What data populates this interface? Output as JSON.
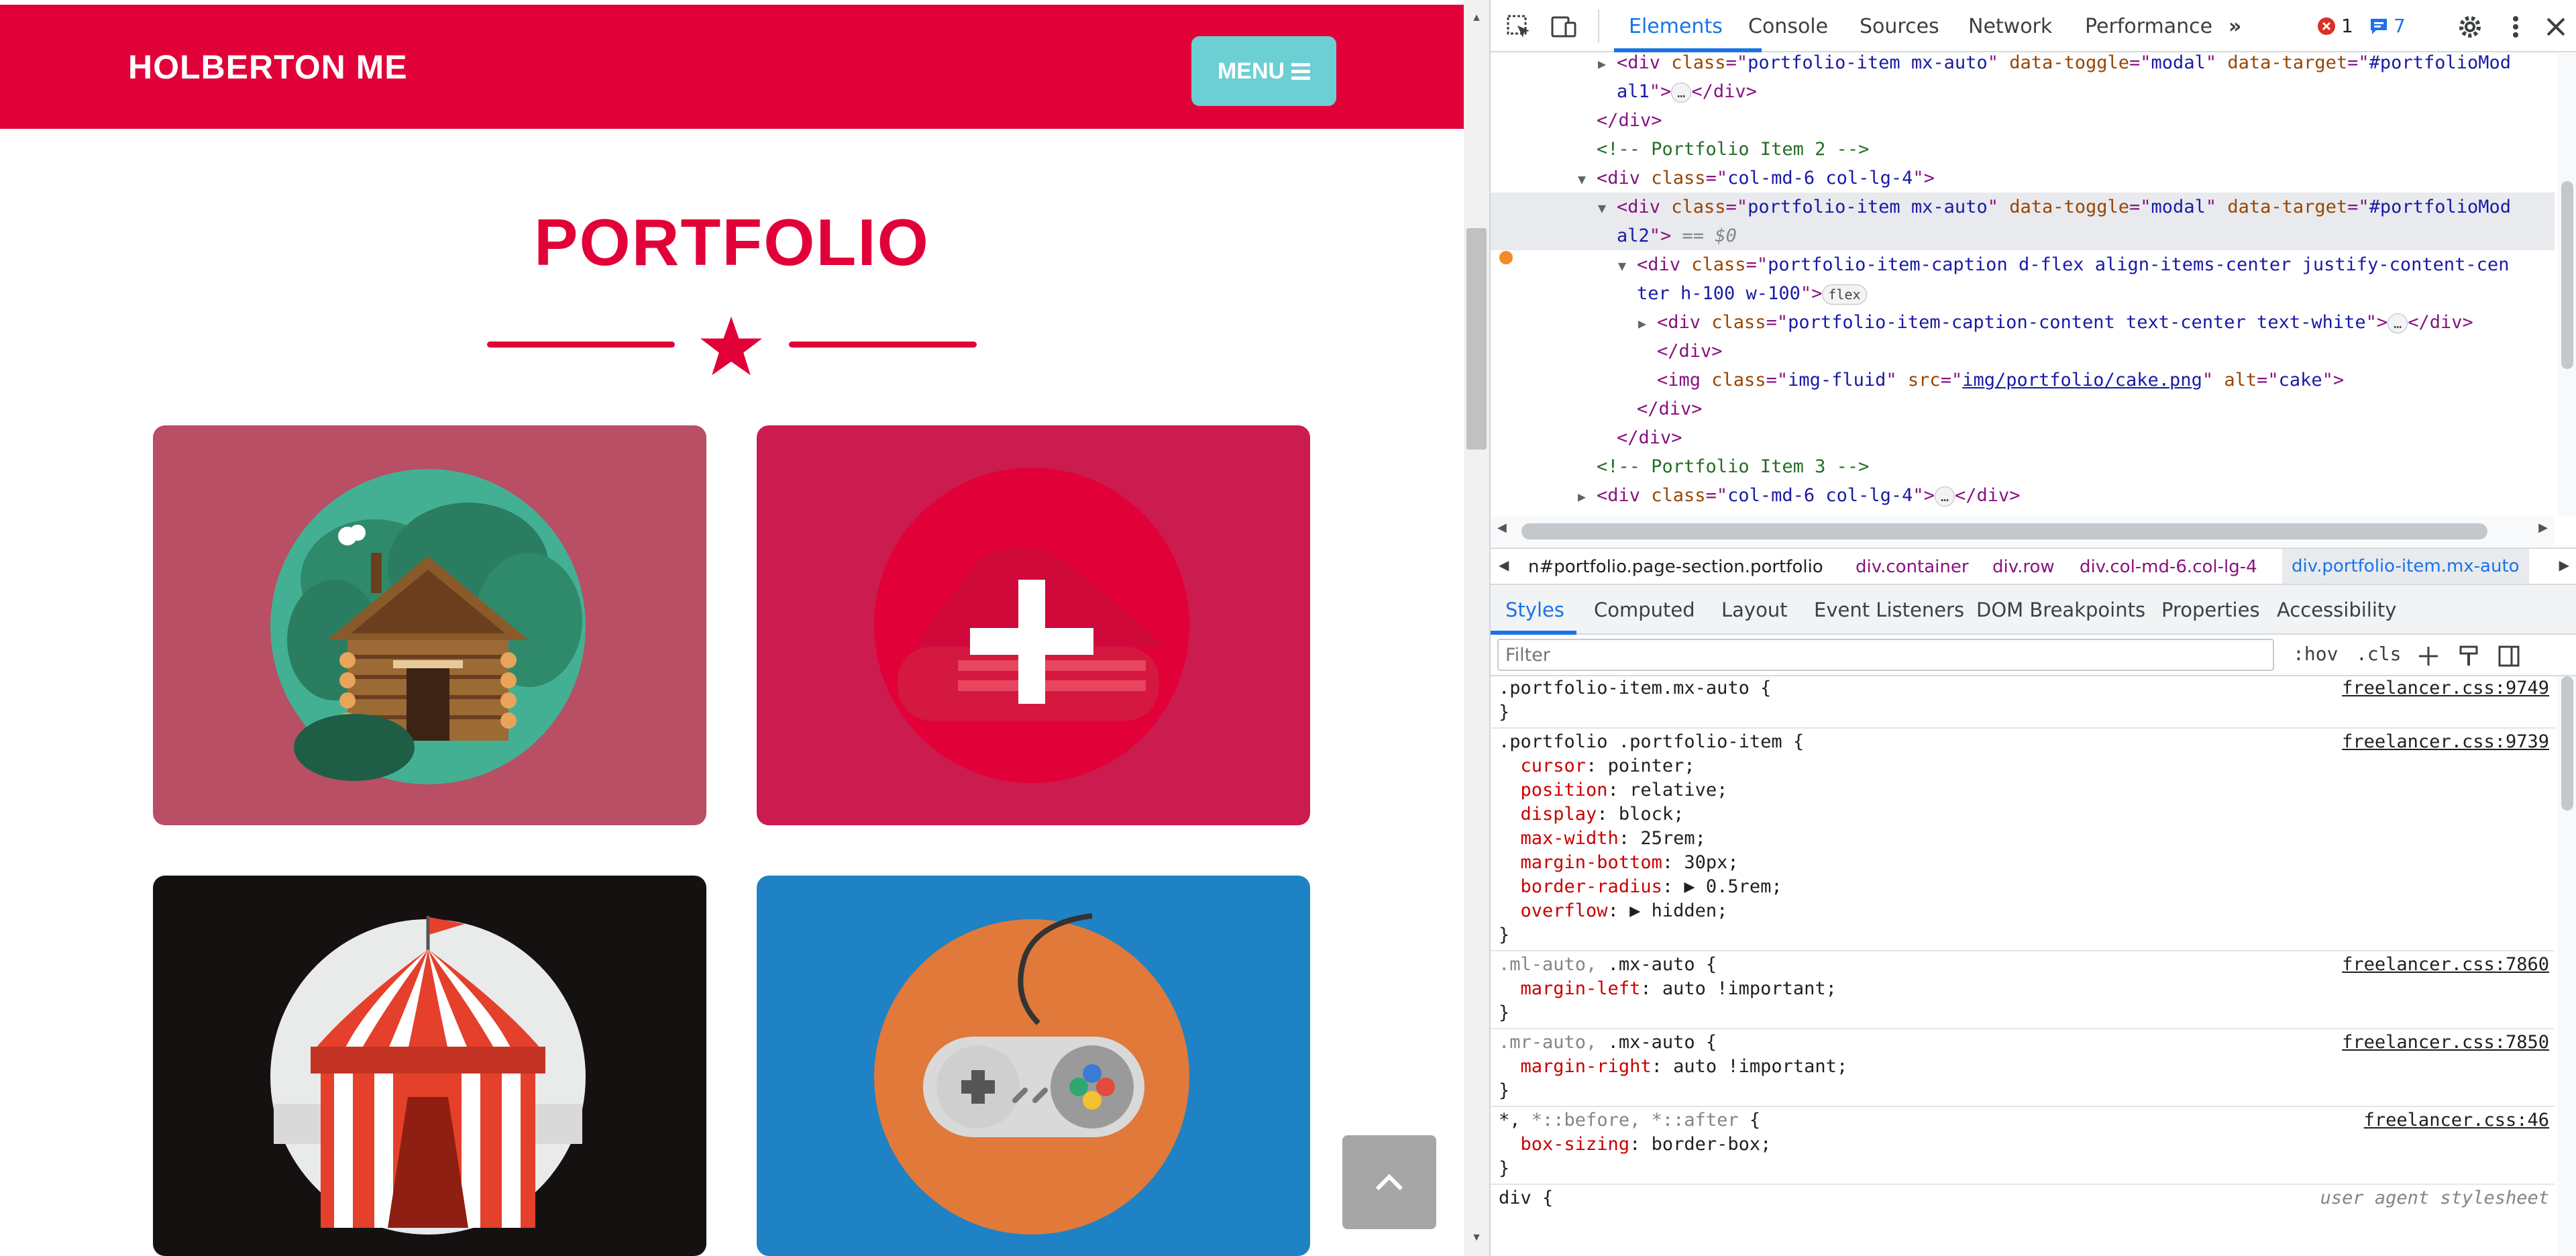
{
  "site": {
    "brand": "HOLBERTON ME",
    "menu_label": "MENU",
    "section_title": "PORTFOLIO",
    "portfolio_items": [
      {
        "name": "cabin",
        "bg": "#b84f64"
      },
      {
        "name": "cake",
        "bg": "#cc1b4e"
      },
      {
        "name": "circus",
        "bg": "#161111"
      },
      {
        "name": "game",
        "bg": "#1e82c4"
      }
    ],
    "colors": {
      "primary": "#e10038",
      "menu": "#6ccfd3"
    }
  },
  "devtools": {
    "tabs": [
      "Elements",
      "Console",
      "Sources",
      "Network",
      "Performance"
    ],
    "active_tab": "Elements",
    "more_tabs": "»",
    "error_count": "1",
    "message_count": "7",
    "dom_lines": [
      {
        "indent": 5,
        "tri": "▶",
        "parts": [
          [
            "tg",
            "<div "
          ],
          [
            "an",
            "class"
          ],
          [
            "tg",
            "=\""
          ],
          [
            "av",
            "portfolio-item mx-auto"
          ],
          [
            "tg",
            "\" "
          ],
          [
            "an",
            "data-toggle"
          ],
          [
            "tg",
            "=\""
          ],
          [
            "av",
            "modal"
          ],
          [
            "tg",
            "\" "
          ],
          [
            "an",
            "data-target"
          ],
          [
            "tg",
            "=\""
          ],
          [
            "av",
            "#portfolioMod"
          ]
        ]
      },
      {
        "indent": 5,
        "tri": "",
        "parts": [
          [
            "av",
            "al1"
          ],
          [
            "tg",
            "\">"
          ],
          [
            "pill",
            "…"
          ],
          [
            "tg",
            "</div>"
          ]
        ]
      },
      {
        "indent": 4,
        "tri": "",
        "parts": [
          [
            "tg",
            "</div>"
          ]
        ]
      },
      {
        "indent": 4,
        "tri": "",
        "parts": [
          [
            "cm",
            "<!-- Portfolio Item 2 -->"
          ]
        ]
      },
      {
        "indent": 4,
        "tri": "▼",
        "parts": [
          [
            "tg",
            "<div "
          ],
          [
            "an",
            "class"
          ],
          [
            "tg",
            "=\""
          ],
          [
            "av",
            "col-md-6 col-lg-4"
          ],
          [
            "tg",
            "\">"
          ]
        ]
      },
      {
        "indent": 5,
        "tri": "▼",
        "sel": true,
        "parts": [
          [
            "tg",
            "<div "
          ],
          [
            "an",
            "class"
          ],
          [
            "tg",
            "=\""
          ],
          [
            "av",
            "portfolio-item mx-auto"
          ],
          [
            "tg",
            "\" "
          ],
          [
            "an",
            "data-toggle"
          ],
          [
            "tg",
            "=\""
          ],
          [
            "av",
            "modal"
          ],
          [
            "tg",
            "\" "
          ],
          [
            "an",
            "data-target"
          ],
          [
            "tg",
            "=\""
          ],
          [
            "av",
            "#portfolioMod"
          ]
        ]
      },
      {
        "indent": 5,
        "tri": "",
        "sel": true,
        "parts": [
          [
            "av",
            "al2"
          ],
          [
            "tg",
            "\">"
          ],
          [
            "eq",
            " == $0"
          ]
        ]
      },
      {
        "indent": 6,
        "tri": "▼",
        "parts": [
          [
            "tg",
            "<div "
          ],
          [
            "an",
            "class"
          ],
          [
            "tg",
            "=\""
          ],
          [
            "av",
            "portfolio-item-caption d-flex align-items-center justify-content-cen"
          ]
        ]
      },
      {
        "indent": 6,
        "tri": "",
        "parts": [
          [
            "av",
            "ter h-100 w-100"
          ],
          [
            "tg",
            "\">"
          ],
          [
            "pill",
            "flex"
          ]
        ]
      },
      {
        "indent": 7,
        "tri": "▶",
        "parts": [
          [
            "tg",
            "<div "
          ],
          [
            "an",
            "class"
          ],
          [
            "tg",
            "=\""
          ],
          [
            "av",
            "portfolio-item-caption-content text-center text-white"
          ],
          [
            "tg",
            "\">"
          ],
          [
            "pill",
            "…"
          ],
          [
            "tg",
            "</div>"
          ]
        ]
      },
      {
        "indent": 7,
        "tri": "",
        "parts": [
          [
            "tg",
            "</div>"
          ]
        ]
      },
      {
        "indent": 7,
        "tri": "",
        "parts": [
          [
            "tg",
            "<img "
          ],
          [
            "an",
            "class"
          ],
          [
            "tg",
            "=\""
          ],
          [
            "av",
            "img-fluid"
          ],
          [
            "tg",
            "\" "
          ],
          [
            "an",
            "src"
          ],
          [
            "tg",
            "=\""
          ],
          [
            "lk",
            "img/portfolio/cake.png"
          ],
          [
            "tg",
            "\" "
          ],
          [
            "an",
            "alt"
          ],
          [
            "tg",
            "=\""
          ],
          [
            "av",
            "cake"
          ],
          [
            "tg",
            "\">"
          ]
        ]
      },
      {
        "indent": 6,
        "tri": "",
        "parts": [
          [
            "tg",
            "</div>"
          ]
        ]
      },
      {
        "indent": 5,
        "tri": "",
        "parts": [
          [
            "tg",
            "</div>"
          ]
        ]
      },
      {
        "indent": 4,
        "tri": "",
        "parts": [
          [
            "cm",
            "<!-- Portfolio Item 3 -->"
          ]
        ]
      },
      {
        "indent": 4,
        "tri": "▶",
        "parts": [
          [
            "tg",
            "<div "
          ],
          [
            "an",
            "class"
          ],
          [
            "tg",
            "=\""
          ],
          [
            "av",
            "col-md-6 col-lg-4"
          ],
          [
            "tg",
            "\">"
          ],
          [
            "pill",
            "…"
          ],
          [
            "tg",
            "</div>"
          ]
        ]
      }
    ],
    "breadcrumbs": [
      "n#portfolio.page-section.portfolio",
      "div.container",
      "div.row",
      "div.col-md-6.col-lg-4",
      "div.portfolio-item.mx-auto"
    ],
    "lower_tabs": [
      "Styles",
      "Computed",
      "Layout",
      "Event Listeners",
      "DOM Breakpoints",
      "Properties",
      "Accessibility"
    ],
    "active_lower_tab": "Styles",
    "filter_placeholder": "Filter",
    "hov_label": ":hov",
    "cls_label": ".cls",
    "style_rules": [
      {
        "selector": ".portfolio-item.mx-auto {",
        "source": "freelancer.css:9749",
        "props": []
      },
      {
        "selector": ".portfolio .portfolio-item {",
        "source": "freelancer.css:9739",
        "props": [
          [
            "cursor",
            "pointer;"
          ],
          [
            "position",
            "relative;"
          ],
          [
            "display",
            "block;"
          ],
          [
            "max-width",
            "25rem;"
          ],
          [
            "margin-bottom",
            "30px;"
          ],
          [
            "border-radius",
            "▶ 0.5rem;"
          ],
          [
            "overflow",
            "▶ hidden;"
          ]
        ]
      },
      {
        "selector_dim": ".ml-auto, ",
        "selector": ".mx-auto {",
        "source": "freelancer.css:7860",
        "props": [
          [
            "margin-left",
            "auto !important;"
          ]
        ]
      },
      {
        "selector_dim": ".mr-auto, ",
        "selector": ".mx-auto {",
        "source": "freelancer.css:7850",
        "props": [
          [
            "margin-right",
            "auto !important;"
          ]
        ]
      },
      {
        "selector": "*, ",
        "selector_dim2": "*::before, *::after",
        "selector_end": " {",
        "source": "freelancer.css:46",
        "props": [
          [
            "box-sizing",
            "border-box;"
          ]
        ]
      },
      {
        "selector": "div {",
        "source": "user agent stylesheet",
        "ua": true,
        "props": []
      }
    ]
  }
}
